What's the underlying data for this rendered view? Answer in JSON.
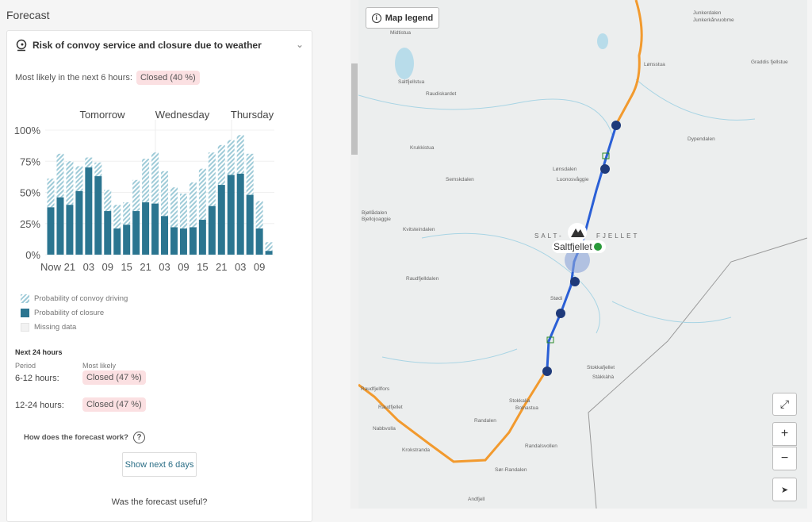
{
  "panel": {
    "title": "Forecast",
    "card_title": "Risk of convoy service and closure due to weather",
    "most_likely_label": "Most likely in the next 6 hours:",
    "most_likely_value": "Closed (40 %)",
    "legend": [
      "Probability of convoy driving",
      "Probability of closure",
      "Missing data"
    ],
    "next24": {
      "title": "Next 24 hours",
      "col_period": "Period",
      "col_likely": "Most likely",
      "rows": [
        {
          "period": "6-12 hours:",
          "value": "Closed (47 %)"
        },
        {
          "period": "12-24 hours:",
          "value": "Closed (47 %)"
        }
      ]
    },
    "help": "How does the forecast work?",
    "help_icon": "?",
    "show_more": "Show next 6 days",
    "useful": "Was the forecast useful?"
  },
  "chart_data": {
    "type": "bar",
    "stacked": true,
    "days": [
      "Tomorrow",
      "Wednesday",
      "Thursday"
    ],
    "y_ticks": [
      "0%",
      "25%",
      "50%",
      "75%",
      "100%"
    ],
    "ylim": [
      0,
      100
    ],
    "x_ticks": [
      "Now",
      "21",
      "03",
      "09",
      "15",
      "21",
      "03",
      "09",
      "15",
      "21",
      "03",
      "09"
    ],
    "series": [
      {
        "name": "Probability of closure",
        "color": "#2b7590",
        "values": [
          38,
          46,
          40,
          51,
          70,
          63,
          35,
          21,
          24,
          35,
          42,
          41,
          31,
          22,
          21,
          22,
          28,
          39,
          56,
          64,
          65,
          48,
          21,
          3
        ]
      },
      {
        "name": "Probability of convoy driving",
        "color": "#9fcbd8",
        "values": [
          23,
          35,
          35,
          20,
          8,
          11,
          17,
          19,
          18,
          25,
          35,
          41,
          36,
          32,
          28,
          36,
          41,
          43,
          32,
          28,
          31,
          33,
          22,
          7
        ]
      }
    ]
  },
  "map": {
    "legend_button": "Map legend",
    "region_label_1": "SALT-",
    "region_label_2": "FJELLET",
    "marker": "Saltfjellet",
    "places": [
      "Midtistua",
      "Saltfjellstua",
      "Raudiskardet",
      "Krukkistua",
      "Semskdalen",
      "Lønsdalen",
      "Luonosvåggie",
      "Lønsstua",
      "Dypendalen",
      "Graddis fjellstue",
      "Junkerdalen",
      "Junkerkårvuobme",
      "Bjøllådalen",
      "Bjellojoaggie",
      "Kvitsteindalen",
      "Raudfjelldalen",
      "Stødi",
      "Stokkalia",
      "Stokkafjellet",
      "Stàkkàhà",
      "Raudfjellfors",
      "Raudfjellet",
      "Nabbvolla",
      "Bolnastua",
      "Randalen",
      "Krokstranda",
      "Randalsvollen",
      "Sør-Randalen",
      "Andfjell"
    ],
    "controls": {
      "fullscreen": "⤢",
      "zoom_in": "+",
      "zoom_out": "−",
      "locate": "➤"
    }
  }
}
